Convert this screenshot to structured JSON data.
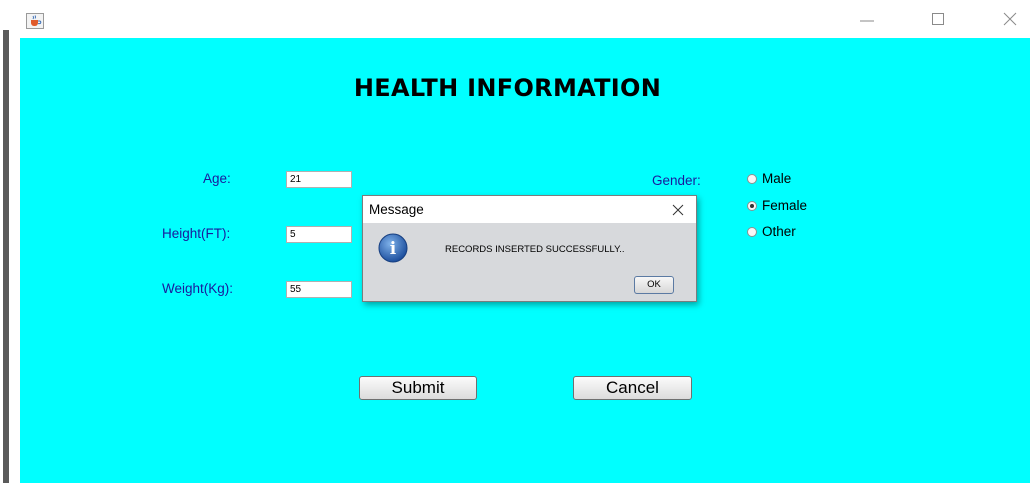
{
  "window": {
    "icon": "java-cup-icon",
    "buttons": [
      "minimize-icon",
      "maximize-icon",
      "close-icon"
    ]
  },
  "form": {
    "title": "HEALTH INFORMATION",
    "background": "#00FFFF",
    "label_color": "#1a1a9c",
    "age": {
      "label": "Age:",
      "value": "21"
    },
    "height": {
      "label": "Height(FT):",
      "value": "5"
    },
    "weight": {
      "label": "Weight(Kg):",
      "value": "55"
    },
    "gender": {
      "label": "Gender:",
      "options": [
        {
          "label": "Male",
          "selected": false
        },
        {
          "label": "Female",
          "selected": true
        },
        {
          "label": "Other",
          "selected": false
        }
      ]
    },
    "submit_label": "Submit",
    "cancel_label": "Cancel"
  },
  "dialog": {
    "title": "Message",
    "icon": "info-icon",
    "message": "RECORDS INSERTED SUCCESSFULLY..",
    "ok_label": "OK"
  }
}
